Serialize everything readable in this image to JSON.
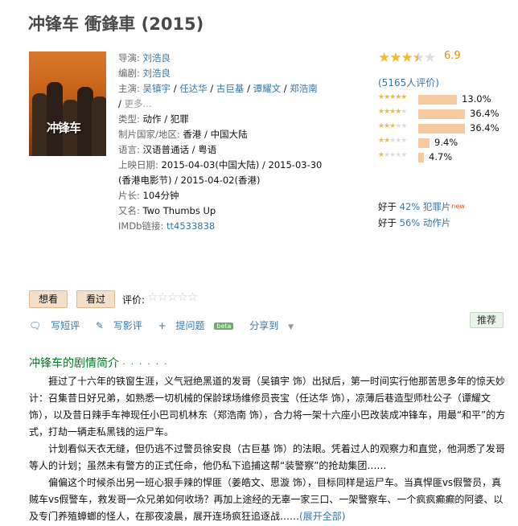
{
  "title": "冲锋车 衝鋒車 (2015)",
  "poster": {
    "text": "冲锋车"
  },
  "info": {
    "director_label": "导演:",
    "director": "刘浩良",
    "writer_label": "编剧:",
    "writer": "刘浩良",
    "cast_label": "主演:",
    "cast": [
      "吴镇宇",
      "任达华",
      "古巨基",
      "谭耀文",
      "郑浩南"
    ],
    "cast_more": "更多...",
    "genre_label": "类型:",
    "genres": [
      "动作",
      "犯罪"
    ],
    "country_label": "制片国家/地区:",
    "country": "香港 / 中国大陆",
    "language_label": "语言:",
    "language": "汉语普通话 / 粤语",
    "release_label": "上映日期:",
    "release_1": "2015-04-03(中国大陆)",
    "release_2": "2015-03-30",
    "release_3": "(香港电影节)",
    "release_4": "2015-04-02(香港)",
    "runtime_label": "片长:",
    "runtime": "104分钟",
    "aka_label": "又名:",
    "aka": "Two Thumbs Up",
    "imdb_label": "IMDb链接:",
    "imdb": "tt4533838"
  },
  "rating": {
    "score": "6.9",
    "stars": 3.5,
    "votes": "(5165人评价)",
    "distribution": [
      {
        "stars": 5,
        "pct": "13.0%",
        "value": 13.0
      },
      {
        "stars": 4,
        "pct": "36.4%",
        "value": 36.4
      },
      {
        "stars": 3,
        "pct": "36.4%",
        "value": 36.4
      },
      {
        "stars": 2,
        "pct": "9.4%",
        "value": 9.4
      },
      {
        "stars": 1,
        "pct": "4.7%",
        "value": 4.7
      }
    ]
  },
  "better_than": [
    {
      "prefix": "好于 ",
      "link": "42% 犯罪片",
      "new": "new"
    },
    {
      "prefix": "好于 ",
      "link": "56% 动作片"
    }
  ],
  "buttons": {
    "want": "想看",
    "seen": "看过"
  },
  "evaluate_label": "评价:",
  "actions": {
    "short_review": "写短评",
    "review": "写影评",
    "ask": "提问题",
    "beta": "beta",
    "share": "分享到"
  },
  "recommend": "推荐",
  "synopsis": {
    "title": "冲锋车的剧情简介",
    "dots": "· · · · · ·",
    "p1": "捱过了十六年的铁窗生涯，义气冠绝黑道的发哥（吴镇宇 饰）出狱后，第一时间实行他那苦思多年的惊天妙计：召集昔日好兄弟，如熟悉一切机械的保龄球场维修员丧宝（任达华 饰），凉薄后巷造型师杜公子（谭耀文 饰），以及昔日辣手车神现任小巴司机林东（郑浩南 饰），合力将一架十六座小巴改装成冲锋车，用最“和平”的方式，打劫一辆走私黑钱的运尸车。",
    "p2": "计划看似天衣无缝，但仍逃不过警员徐安良（古巨基 饰）的法眼。凭着过人的观察力和直觉，他洞悉了发哥等人的计划；虽然未有警方的正式任命，他仍私下追捕这帮“装警察”的抢劫集团……",
    "p3": "偏偏这个时候杀出另一班心狠手辣的悍匪（姜皓文、思漩 饰），目标同样是运尸车。当真悍匪vs假警员，真贼车vs假警车，救发哥一众兄弟如何收场？再加上途经的无辜一家三口、一架警察车、一个疯疯癫癫的阿婆、以及专门养殖蟑螂的怪人，在那夜凌晨，展开连场疯狂追逐战……",
    "more": "(展开全部)"
  }
}
